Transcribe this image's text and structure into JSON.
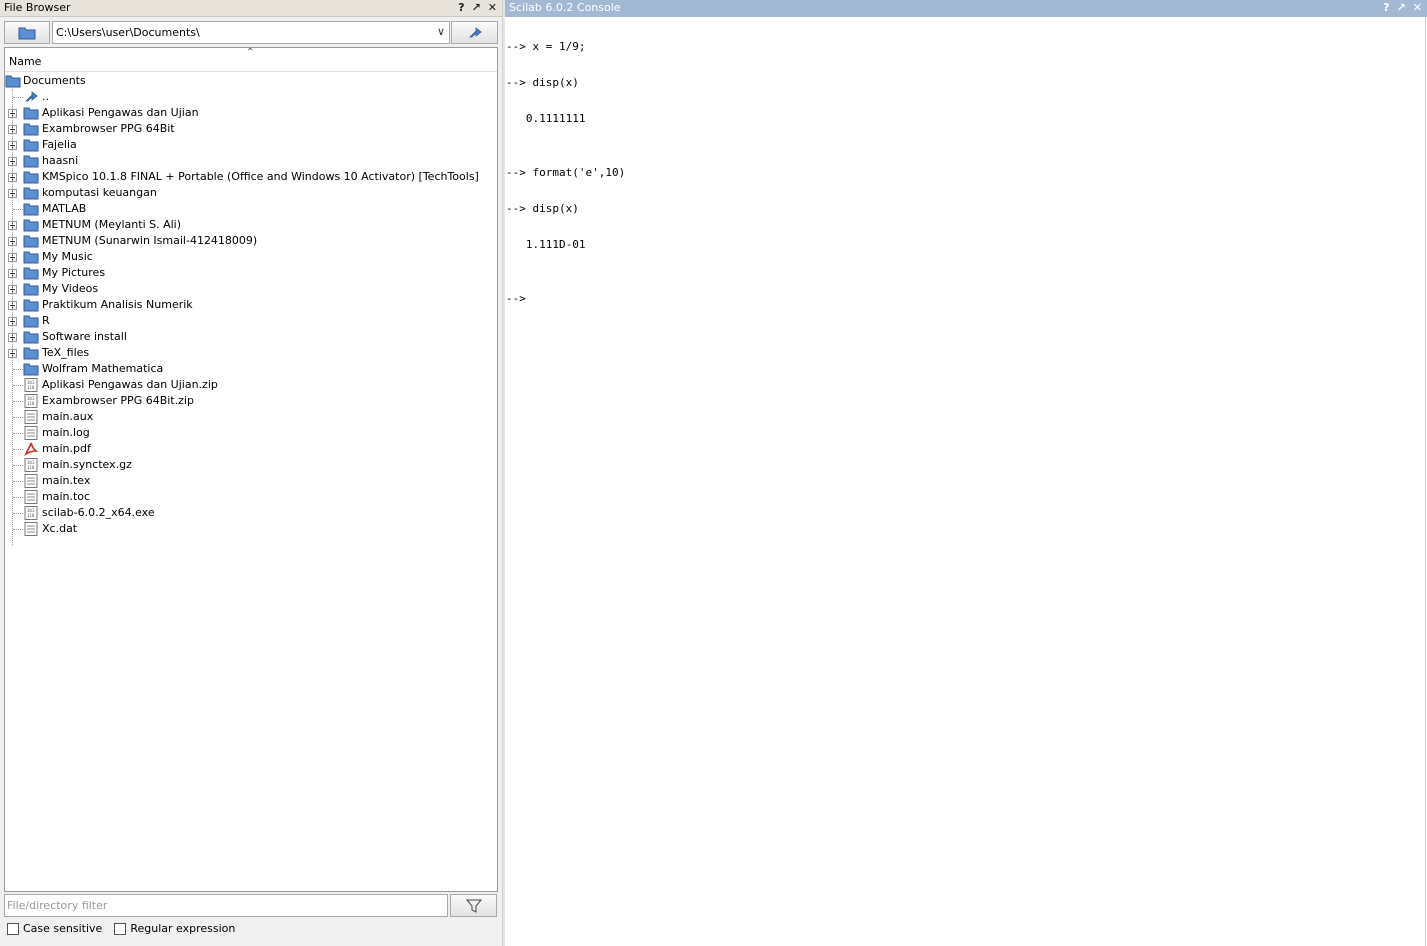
{
  "file_browser": {
    "title": "File Browser",
    "title_buttons": [
      "?",
      "↗",
      "✕"
    ],
    "path": "C:\\Users\\user\\Documents\\",
    "column_name": "Name",
    "root": "Documents",
    "parent": "..",
    "items": [
      {
        "label": "Aplikasi Pengawas dan Ujian",
        "kind": "folder",
        "expandable": true
      },
      {
        "label": "Exambrowser PPG 64Bit",
        "kind": "folder",
        "expandable": true
      },
      {
        "label": "Fajelia",
        "kind": "folder",
        "expandable": true
      },
      {
        "label": "haasni",
        "kind": "folder",
        "expandable": true
      },
      {
        "label": "KMSpico 10.1.8 FINAL + Portable (Office and Windows 10 Activator) [TechTools]",
        "kind": "folder",
        "expandable": true
      },
      {
        "label": "komputasi keuangan",
        "kind": "folder",
        "expandable": true
      },
      {
        "label": "MATLAB",
        "kind": "folder",
        "expandable": false
      },
      {
        "label": "METNUM (Meylanti S. Ali)",
        "kind": "folder",
        "expandable": true
      },
      {
        "label": "METNUM (Sunarwin Ismail-412418009)",
        "kind": "folder",
        "expandable": true
      },
      {
        "label": "My Music",
        "kind": "folder",
        "expandable": true
      },
      {
        "label": "My Pictures",
        "kind": "folder",
        "expandable": true
      },
      {
        "label": "My Videos",
        "kind": "folder",
        "expandable": true
      },
      {
        "label": "Praktikum Analisis Numerik",
        "kind": "folder",
        "expandable": true
      },
      {
        "label": "R",
        "kind": "folder",
        "expandable": true
      },
      {
        "label": "Software install",
        "kind": "folder",
        "expandable": true
      },
      {
        "label": "TeX_files",
        "kind": "folder",
        "expandable": true
      },
      {
        "label": "Wolfram Mathematica",
        "kind": "folder",
        "expandable": false
      },
      {
        "label": "Aplikasi Pengawas dan Ujian.zip",
        "kind": "binary",
        "expandable": false
      },
      {
        "label": "Exambrowser PPG 64Bit.zip",
        "kind": "binary",
        "expandable": false
      },
      {
        "label": "main.aux",
        "kind": "text",
        "expandable": false
      },
      {
        "label": "main.log",
        "kind": "text",
        "expandable": false
      },
      {
        "label": "main.pdf",
        "kind": "pdf",
        "expandable": false
      },
      {
        "label": "main.synctex.gz",
        "kind": "binary",
        "expandable": false
      },
      {
        "label": "main.tex",
        "kind": "text",
        "expandable": false
      },
      {
        "label": "main.toc",
        "kind": "text",
        "expandable": false
      },
      {
        "label": "scilab-6.0.2_x64.exe",
        "kind": "binary",
        "expandable": false
      },
      {
        "label": "Xc.dat",
        "kind": "text",
        "expandable": false
      }
    ],
    "filter_placeholder": "File/directory filter",
    "case_sensitive_label": "Case sensitive",
    "regex_label": "Regular expression"
  },
  "console": {
    "title": "Scilab 6.0.2 Console",
    "title_buttons": [
      "?",
      "↗",
      "✕"
    ],
    "lines": [
      "--> x = 1/9;",
      "--> disp(x)",
      "   0.1111111",
      "--> format('e',10)",
      "--> disp(x)",
      "   1.111D-01",
      "-->"
    ]
  },
  "colors": {
    "console_title_bg": "#a3b9d3",
    "file_browser_title_bg": "#e8e4dc",
    "folder_icon": "#5b8fd1"
  }
}
